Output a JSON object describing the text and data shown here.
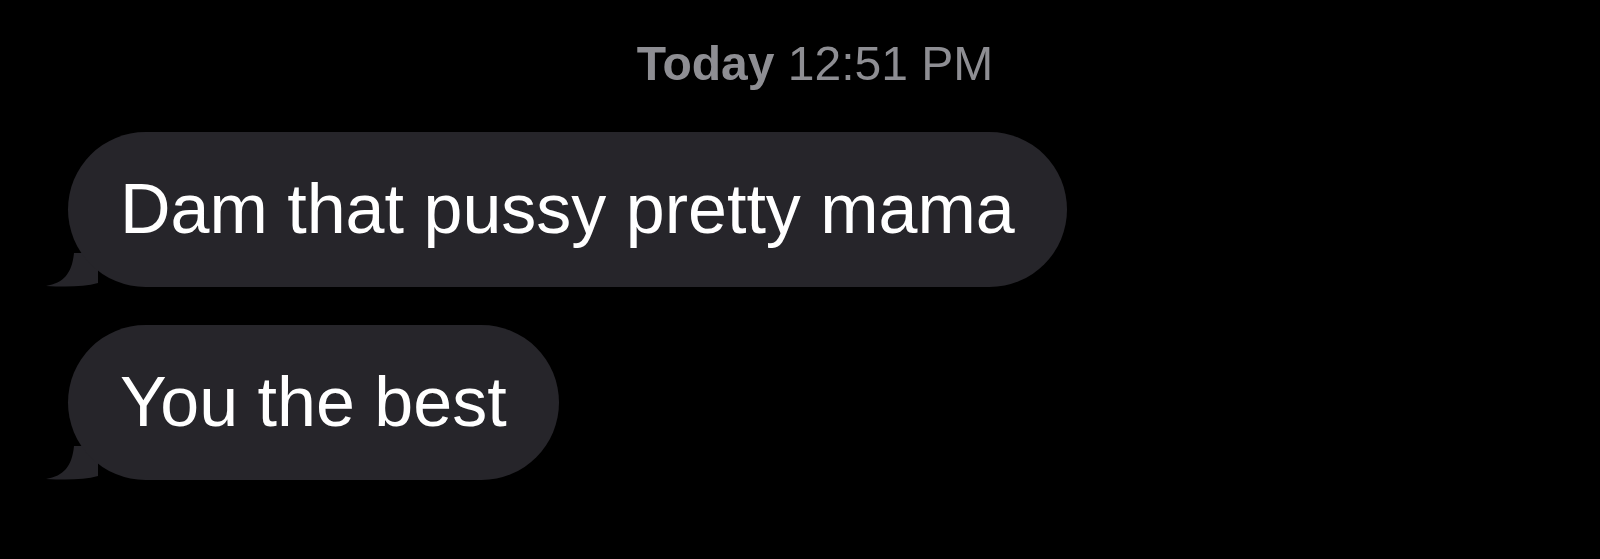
{
  "timestamp": "**Today** 12:51 PM",
  "messages": [
    {
      "text": "Dam that pussy pretty mama",
      "kind": "incoming"
    },
    {
      "text": "You the best",
      "kind": "incoming"
    }
  ]
}
